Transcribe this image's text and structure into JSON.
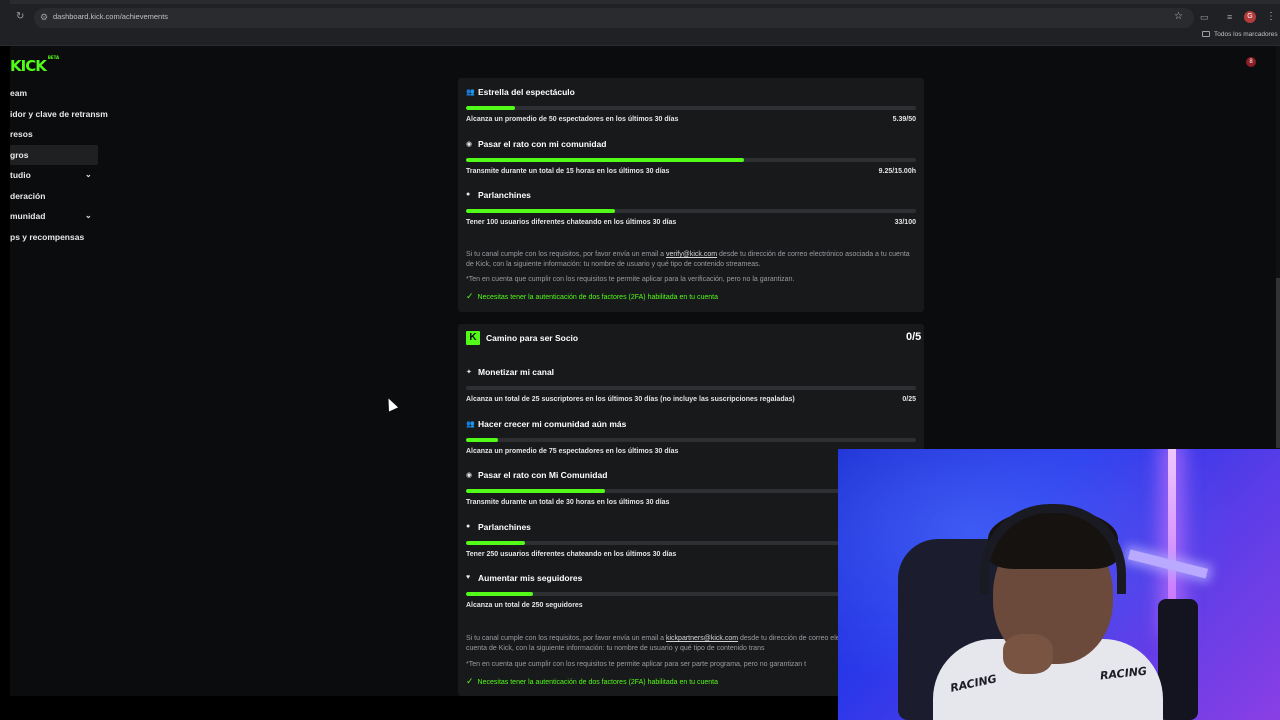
{
  "browser": {
    "url": "dashboard.kick.com/achievements",
    "bookmarks_label": "Todos los marcadores",
    "profile_initial": "G"
  },
  "app": {
    "logo": "KICK",
    "logo_tag": "BETA",
    "notification_count": "8",
    "sidebar": [
      {
        "label": "eam",
        "expandable": false,
        "active": false
      },
      {
        "label": "idor y clave de retransm",
        "expandable": false,
        "active": false
      },
      {
        "label": "resos",
        "expandable": false,
        "active": false
      },
      {
        "label": "gros",
        "expandable": false,
        "active": true
      },
      {
        "label": "tudio",
        "expandable": true,
        "active": false
      },
      {
        "label": "deración",
        "expandable": false,
        "active": false
      },
      {
        "label": "munidad",
        "expandable": true,
        "active": false
      },
      {
        "label": "ps y recompensas",
        "expandable": false,
        "active": false
      }
    ]
  },
  "verification": {
    "achievements": [
      {
        "icon": "users-icon",
        "title": "Estrella del espectáculo",
        "description": "Alcanza un promedio de 50 espectadores en los últimos 30 días",
        "progress": "5.39/50",
        "fill_fraction": 0.108
      },
      {
        "icon": "radio-icon",
        "title": "Pasar el rato con mi comunidad",
        "description": "Transmite durante un total de 15 horas en los últimos 30 días",
        "progress": "9.25/15.00h",
        "fill_fraction": 0.617
      },
      {
        "icon": "chat-icon",
        "title": "Parlanchines",
        "description": "Tener 100 usuarios diferentes chateando en los últimos 30 días",
        "progress": "33/100",
        "fill_fraction": 0.33
      }
    ],
    "note_prefix": "Si tu canal cumple con los requisitos, por favor envía un email a ",
    "note_email": "verify@kick.com",
    "note_suffix": " desde tu dirección de correo electrónico asociada a tu cuenta de Kick, con la siguiente información: tu nombre de usuario y qué tipo de contenido streameas.",
    "note_disclaimer": "*Ten en cuenta que cumplir con los requisitos te permite aplicar para la verificación, pero no la garantizan.",
    "twofa_text": "Necesitas tener la autenticación de dos factores (2FA) habilitada en tu cuenta"
  },
  "partner": {
    "badge": "K",
    "title": "Camino para ser Socio",
    "score": "0/5",
    "achievements": [
      {
        "icon": "sparkle-icon",
        "title": "Monetizar mi canal",
        "description": "Alcanza un total de 25 suscriptores en los últimos 30 días (no incluye las suscripciones regaladas)",
        "progress": "0/25",
        "fill_fraction": 0.0
      },
      {
        "icon": "users-icon",
        "title": "Hacer crecer mi comunidad aún más",
        "description": "Alcanza un promedio de 75 espectadores en los últimos 30 días",
        "progress": "",
        "fill_fraction": 0.072
      },
      {
        "icon": "radio-icon",
        "title": "Pasar el rato con Mi Comunidad",
        "description": "Transmite durante un total de 30 horas en los últimos 30 días",
        "progress": "",
        "fill_fraction": 0.308
      },
      {
        "icon": "chat-icon",
        "title": "Parlanchines",
        "description": "Tener 250 usuarios diferentes chateando en los últimos 30 días",
        "progress": "",
        "fill_fraction": 0.132
      },
      {
        "icon": "heart-icon",
        "title": "Aumentar mis seguidores",
        "description": "Alcanza un total de 250 seguidores",
        "progress": "",
        "fill_fraction": 0.148
      }
    ],
    "note_prefix": "Si tu canal cumple con los requisitos, por favor envía un email a ",
    "note_email": "kickpartners@kick.com",
    "note_suffix": " desde tu dirección de correo electrónico asociada a tu cuenta de Kick, con la siguiente información: tu nombre de usuario y qué tipo de contenido trans",
    "note_disclaimer": "*Ten en cuenta que cumplir con los requisitos te permite aplicar para ser parte programa, pero no garantizan t",
    "twofa_text": "Necesitas tener la autenticación de dos factores (2FA) habilitada en tu cuenta"
  },
  "webcam": {
    "shirt_text_left": "RACING",
    "shirt_text_right": "RACING"
  },
  "colors": {
    "accent": "#53fc18",
    "card_bg": "#18191b",
    "page_bg": "#0b0c0d"
  }
}
